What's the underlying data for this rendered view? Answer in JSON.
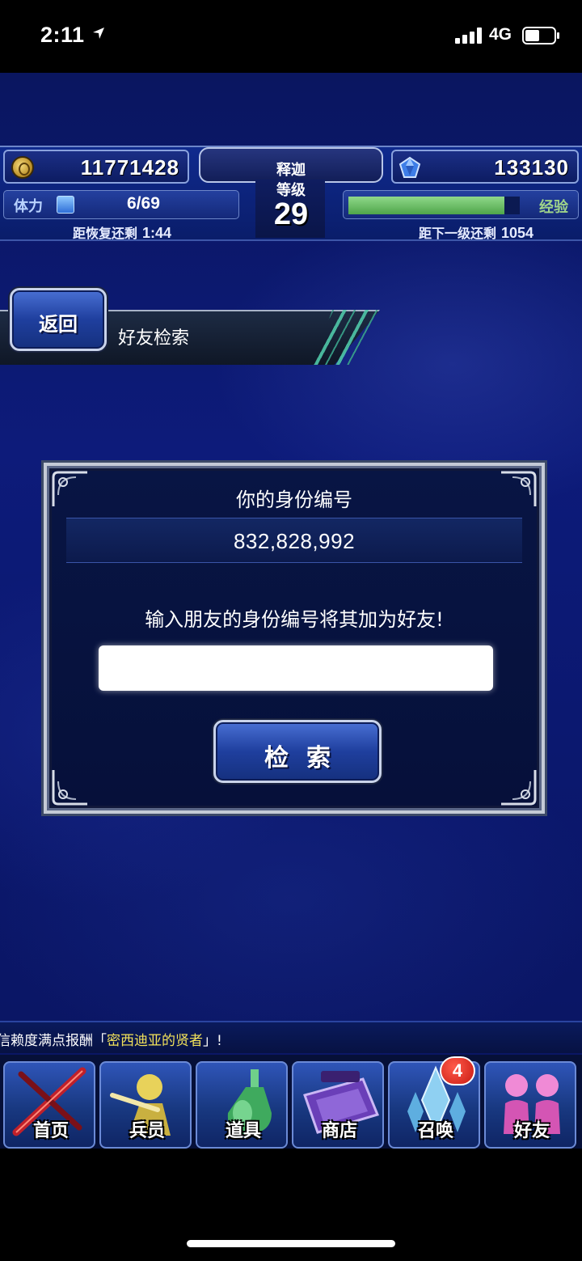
{
  "status_bar": {
    "time": "2:11",
    "network": "4G"
  },
  "hud": {
    "gil": "11771428",
    "gems": "133130",
    "stamina_label": "体力",
    "stamina_value": "6/69",
    "stamina_recover_label": "距恢复还剩",
    "stamina_recover_time": "1:44",
    "player_name": "释迦",
    "level_label": "等级",
    "level_value": "29",
    "exp_label": "经验",
    "exp_fraction": 0.91,
    "exp_next_label": "距下一级还剩",
    "exp_next_value": "1054"
  },
  "header": {
    "back_label": "返回",
    "title": "好友检索"
  },
  "panel": {
    "id_title": "你的身份编号",
    "id_value": "832,828,992",
    "prompt": "输入朋友的身份编号将其加为好友!",
    "input_value": "",
    "input_placeholder": "",
    "search_label": "检索"
  },
  "ticker": {
    "prefix": "信赖度满点报酬「",
    "highlight": "密西迪亚的贤者",
    "suffix": "」!"
  },
  "nav": {
    "items": [
      {
        "label": "首页",
        "icon": "sword-icon"
      },
      {
        "label": "兵员",
        "icon": "hero-icon"
      },
      {
        "label": "道具",
        "icon": "potion-icon"
      },
      {
        "label": "商店",
        "icon": "shop-icon"
      },
      {
        "label": "召唤",
        "icon": "crystal-icon"
      },
      {
        "label": "好友",
        "icon": "friends-icon"
      }
    ],
    "summon_badge": "4"
  },
  "colors": {
    "accent": "#1f3f9e",
    "exp_bar": "#4fa64a",
    "highlight": "#f2e25a",
    "badge": "#c81a12"
  }
}
